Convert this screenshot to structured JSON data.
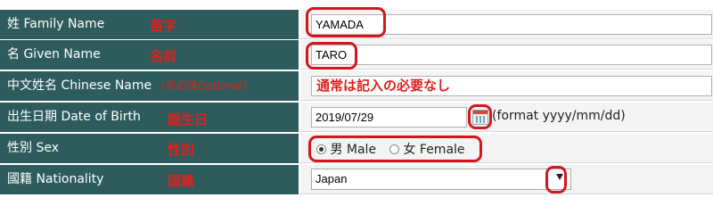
{
  "rows": [
    {
      "label": "姓 Family Name",
      "note": "苗字",
      "value": "YAMADA"
    },
    {
      "label": "名 Given Name",
      "note": "名前",
      "value": "TARO"
    },
    {
      "label": "中文姓名 Chinese Name",
      "optional": "(非必填Optional)",
      "note": "通常は記入の必要なし",
      "value": ""
    },
    {
      "label": "出生日期 Date of Birth",
      "note": "誕生日",
      "value": "2019/07/29",
      "hint": "(format yyyy/mm/dd)",
      "icon": "calendar-icon"
    },
    {
      "label": "性別 Sex",
      "note": "性別",
      "options": [
        "男 Male",
        "女 Female"
      ],
      "selected": "男 Male"
    },
    {
      "label": "國籍 Nationality",
      "note": "国籍",
      "value": "Japan",
      "icon": "chevron-down-icon"
    }
  ],
  "colors": {
    "label_bg": "#2e5c5c",
    "annotation": "#e0201d",
    "value_bg": "#f4f4f4"
  }
}
